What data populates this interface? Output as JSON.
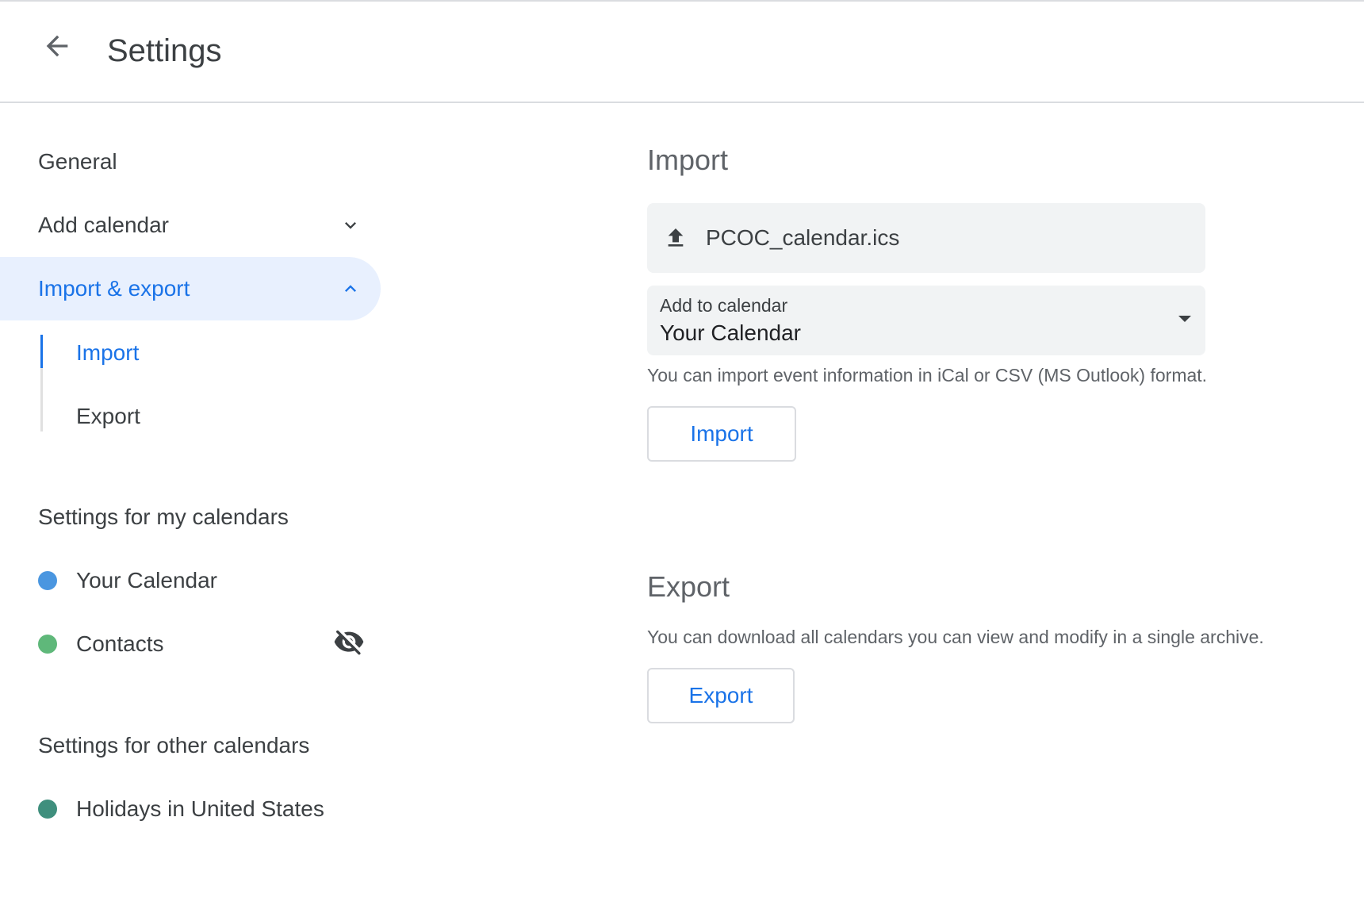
{
  "header": {
    "title": "Settings",
    "back_icon": "arrow-back-icon"
  },
  "sidebar": {
    "general": "General",
    "add_calendar": "Add calendar",
    "import_export": "Import & export",
    "sub_items": {
      "import": "Import",
      "export": "Export"
    },
    "my_calendars_heading": "Settings for my calendars",
    "my_calendars": [
      {
        "label": "Your Calendar",
        "color": "#4a96e0"
      },
      {
        "label": "Contacts",
        "color": "#5fb87a",
        "hidden": true
      }
    ],
    "other_calendars_heading": "Settings for other calendars",
    "other_calendars": [
      {
        "label": "Holidays in United States",
        "color": "#3f8f7d"
      }
    ]
  },
  "import": {
    "heading": "Import",
    "file_name": "PCOC_calendar.ics",
    "select_label": "Add to calendar",
    "select_value": "Your Calendar",
    "helper": "You can import event information in iCal or CSV (MS Outlook) format.",
    "button": "Import"
  },
  "export": {
    "heading": "Export",
    "helper": "You can download all calendars you can view and modify in a single archive.",
    "button": "Export"
  },
  "colors": {
    "accent": "#1a73e8",
    "active_bg": "#e8f0fe"
  }
}
